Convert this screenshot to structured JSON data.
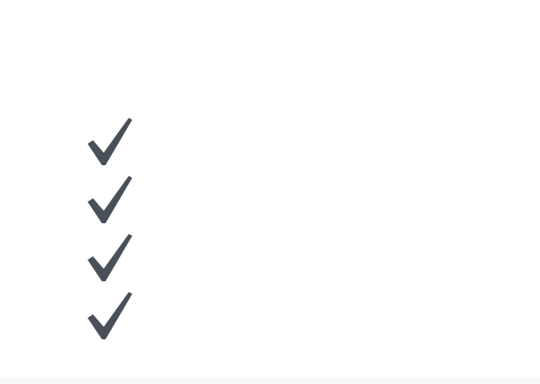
{
  "checklist": {
    "items": [
      {
        "icon": "checkmark-icon"
      },
      {
        "icon": "checkmark-icon"
      },
      {
        "icon": "checkmark-icon"
      },
      {
        "icon": "checkmark-icon"
      }
    ]
  },
  "colors": {
    "background": "#ffffff",
    "checkmark": "#4a5058",
    "bottom_strip": "#f7f8f9"
  }
}
